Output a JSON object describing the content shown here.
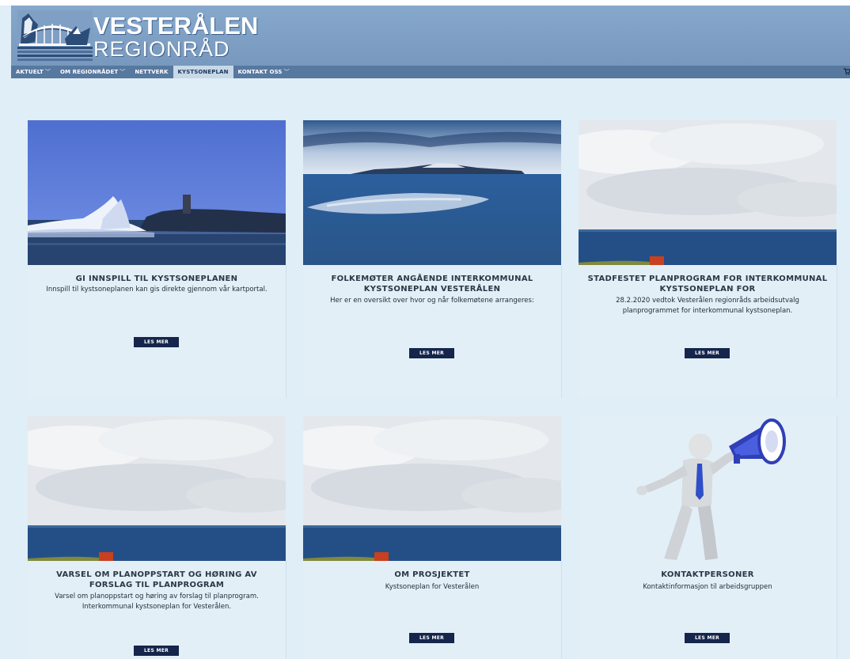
{
  "site": {
    "logo_line1": "VESTERÅLEN",
    "logo_line2": "REGIONRÅD"
  },
  "nav": [
    {
      "label": "AKTUELT",
      "has_menu": true,
      "active": false
    },
    {
      "label": "OM REGIONRÅDET",
      "has_menu": true,
      "active": false
    },
    {
      "label": "NETTVERK",
      "has_menu": false,
      "active": false
    },
    {
      "label": "KYSTSONEPLAN",
      "has_menu": false,
      "active": true
    },
    {
      "label": "KONTAKT OSS",
      "has_menu": true,
      "active": false
    }
  ],
  "cards": [
    {
      "title": "GI INNSPILL TIL KYSTSONEPLANEN",
      "description": "Innspill til kystsoneplanen kan gis direkte gjennom vår kartportal.",
      "button": "LES MER",
      "image": "wave-on-rock"
    },
    {
      "title": "FOLKEMØTER ANGÅENDE INTERKOMMUNAL KYSTSONEPLAN VESTERÅLEN",
      "description": "Her er en oversikt over hvor og når folkemøtene arrangeres:",
      "button": "LES MER",
      "image": "sea-with-distant-islands"
    },
    {
      "title": "STADFESTET PLANPROGRAM FOR INTERKOMMUNAL KYSTSONEPLAN FOR",
      "description": "28.2.2020 vedtok Vesterålen regionråds arbeidsutvalg planprogrammet for interkommunal kystsoneplan.",
      "button": "LES MER",
      "image": "cloudy-sea-horizon"
    },
    {
      "title": "VARSEL OM PLANOPPSTART OG HØRING AV FORSLAG TIL PLANPROGRAM",
      "description": "Varsel om planoppstart og høring av forslag til planprogram. Interkommunal kystsoneplan for Vesterålen.",
      "button": "LES MER",
      "image": "cloudy-sea-horizon"
    },
    {
      "title": "OM PROSJEKTET",
      "description": "Kystsoneplan for Vesterålen",
      "button": "LES MER",
      "image": "cloudy-sea-horizon"
    },
    {
      "title": "KONTAKTPERSONER",
      "description": "Kontaktinformasjon til arbeidsgruppen",
      "button": "LES MER",
      "image": "figure-with-megaphone"
    }
  ],
  "colors": {
    "page_bg": "#dfeef7",
    "header_bg": "#7f9fc4",
    "nav_bg": "#57789f",
    "nav_active_bg": "#c7d8e8",
    "button_bg": "#15254c"
  }
}
